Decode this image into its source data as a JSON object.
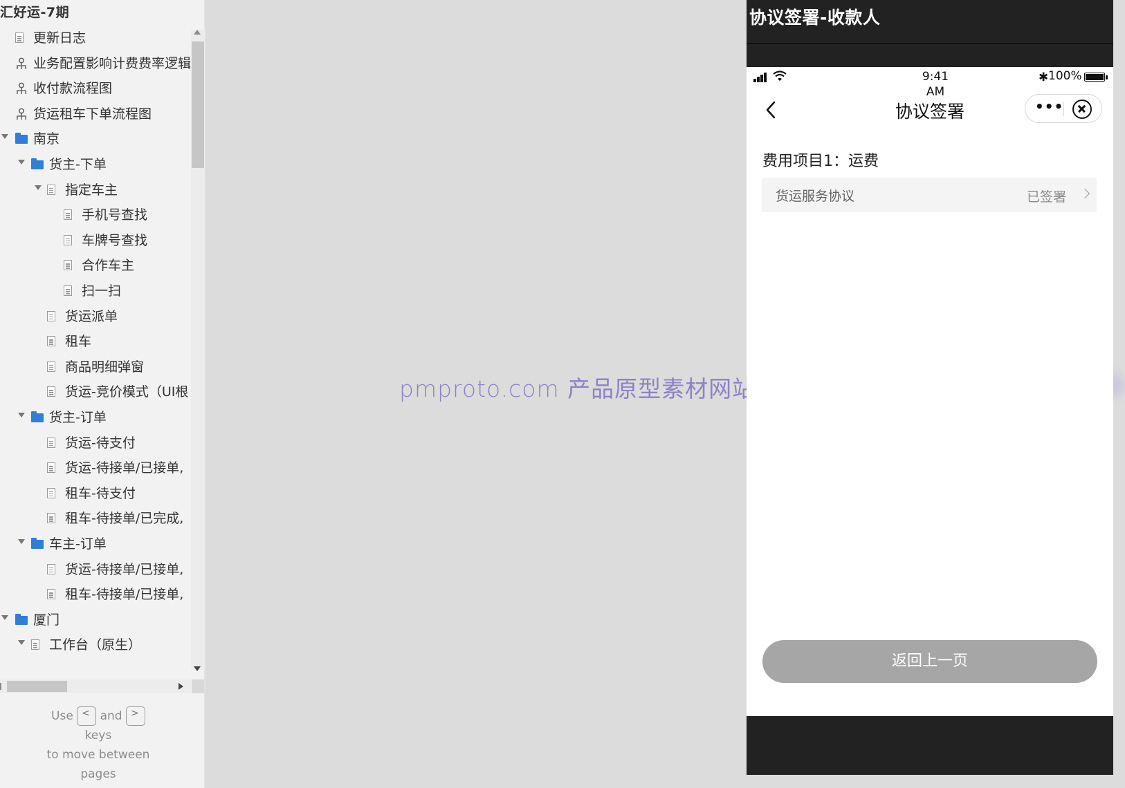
{
  "sidebar": {
    "project_title": "汇好运-7期",
    "items": [
      {
        "label": "更新日志",
        "type": "page",
        "level": 0,
        "expanded": false
      },
      {
        "label": "业务配置影响计费费率逻辑",
        "type": "flow",
        "level": 0,
        "expanded": false
      },
      {
        "label": "收付款流程图",
        "type": "flow",
        "level": 0,
        "expanded": false
      },
      {
        "label": "货运租车下单流程图",
        "type": "flow",
        "level": 0,
        "expanded": false
      },
      {
        "label": "南京",
        "type": "folder",
        "level": 0,
        "expanded": true
      },
      {
        "label": "货主-下单",
        "type": "folder",
        "level": 1,
        "expanded": true
      },
      {
        "label": "指定车主",
        "type": "page",
        "level": 2,
        "expanded": true
      },
      {
        "label": "手机号查找",
        "type": "page",
        "level": 3,
        "expanded": false
      },
      {
        "label": "车牌号查找",
        "type": "page",
        "level": 3,
        "expanded": false
      },
      {
        "label": "合作车主",
        "type": "page",
        "level": 3,
        "expanded": false
      },
      {
        "label": "扫一扫",
        "type": "page",
        "level": 3,
        "expanded": false
      },
      {
        "label": "货运派单",
        "type": "page",
        "level": 2,
        "expanded": false
      },
      {
        "label": "租车",
        "type": "page",
        "level": 2,
        "expanded": false
      },
      {
        "label": "商品明细弹窗",
        "type": "page",
        "level": 2,
        "expanded": false
      },
      {
        "label": "货运-竞价模式（UI根",
        "type": "page",
        "level": 2,
        "expanded": false
      },
      {
        "label": "货主-订单",
        "type": "folder",
        "level": 1,
        "expanded": true
      },
      {
        "label": "货运-待支付",
        "type": "page",
        "level": 2,
        "expanded": false
      },
      {
        "label": "货运-待接单/已接单,",
        "type": "page",
        "level": 2,
        "expanded": false
      },
      {
        "label": "租车-待支付",
        "type": "page",
        "level": 2,
        "expanded": false
      },
      {
        "label": "租车-待接单/已完成,",
        "type": "page",
        "level": 2,
        "expanded": false
      },
      {
        "label": "车主-订单",
        "type": "folder",
        "level": 1,
        "expanded": true
      },
      {
        "label": "货运-待接单/已接单,",
        "type": "page",
        "level": 2,
        "expanded": false
      },
      {
        "label": "租车-待接单/已接单,",
        "type": "page",
        "level": 2,
        "expanded": false
      },
      {
        "label": "厦门",
        "type": "folder",
        "level": 0,
        "expanded": true
      },
      {
        "label": "工作台（原生）",
        "type": "page",
        "level": 1,
        "expanded": true
      }
    ],
    "hint": {
      "use": "Use",
      "prev_key": "<",
      "and": "and",
      "next_key": ">",
      "keys": "keys",
      "move": "to move between",
      "pages": "pages"
    }
  },
  "watermark": "pmproto.com 产品原型素材网站",
  "phone": {
    "page_title": "协议签署-收款人",
    "status_bar": {
      "time": "9:41\nAM",
      "battery": "100%",
      "bluetooth": "✱"
    },
    "nav": {
      "title": "协议签署",
      "more": "•••"
    },
    "fee_title": "费用项目1：运费",
    "agreement": {
      "name": "货运服务协议",
      "status": "已签署"
    },
    "back_button_label": "返回上一页"
  },
  "icons": {
    "page": "page-icon",
    "flow": "flow-icon",
    "folder": "folder-icon"
  },
  "colors": {
    "folder": "#2f7fd6",
    "watermark": "#8e82c4",
    "button_bg": "#a6a6a6",
    "header_bg": "#222222"
  }
}
